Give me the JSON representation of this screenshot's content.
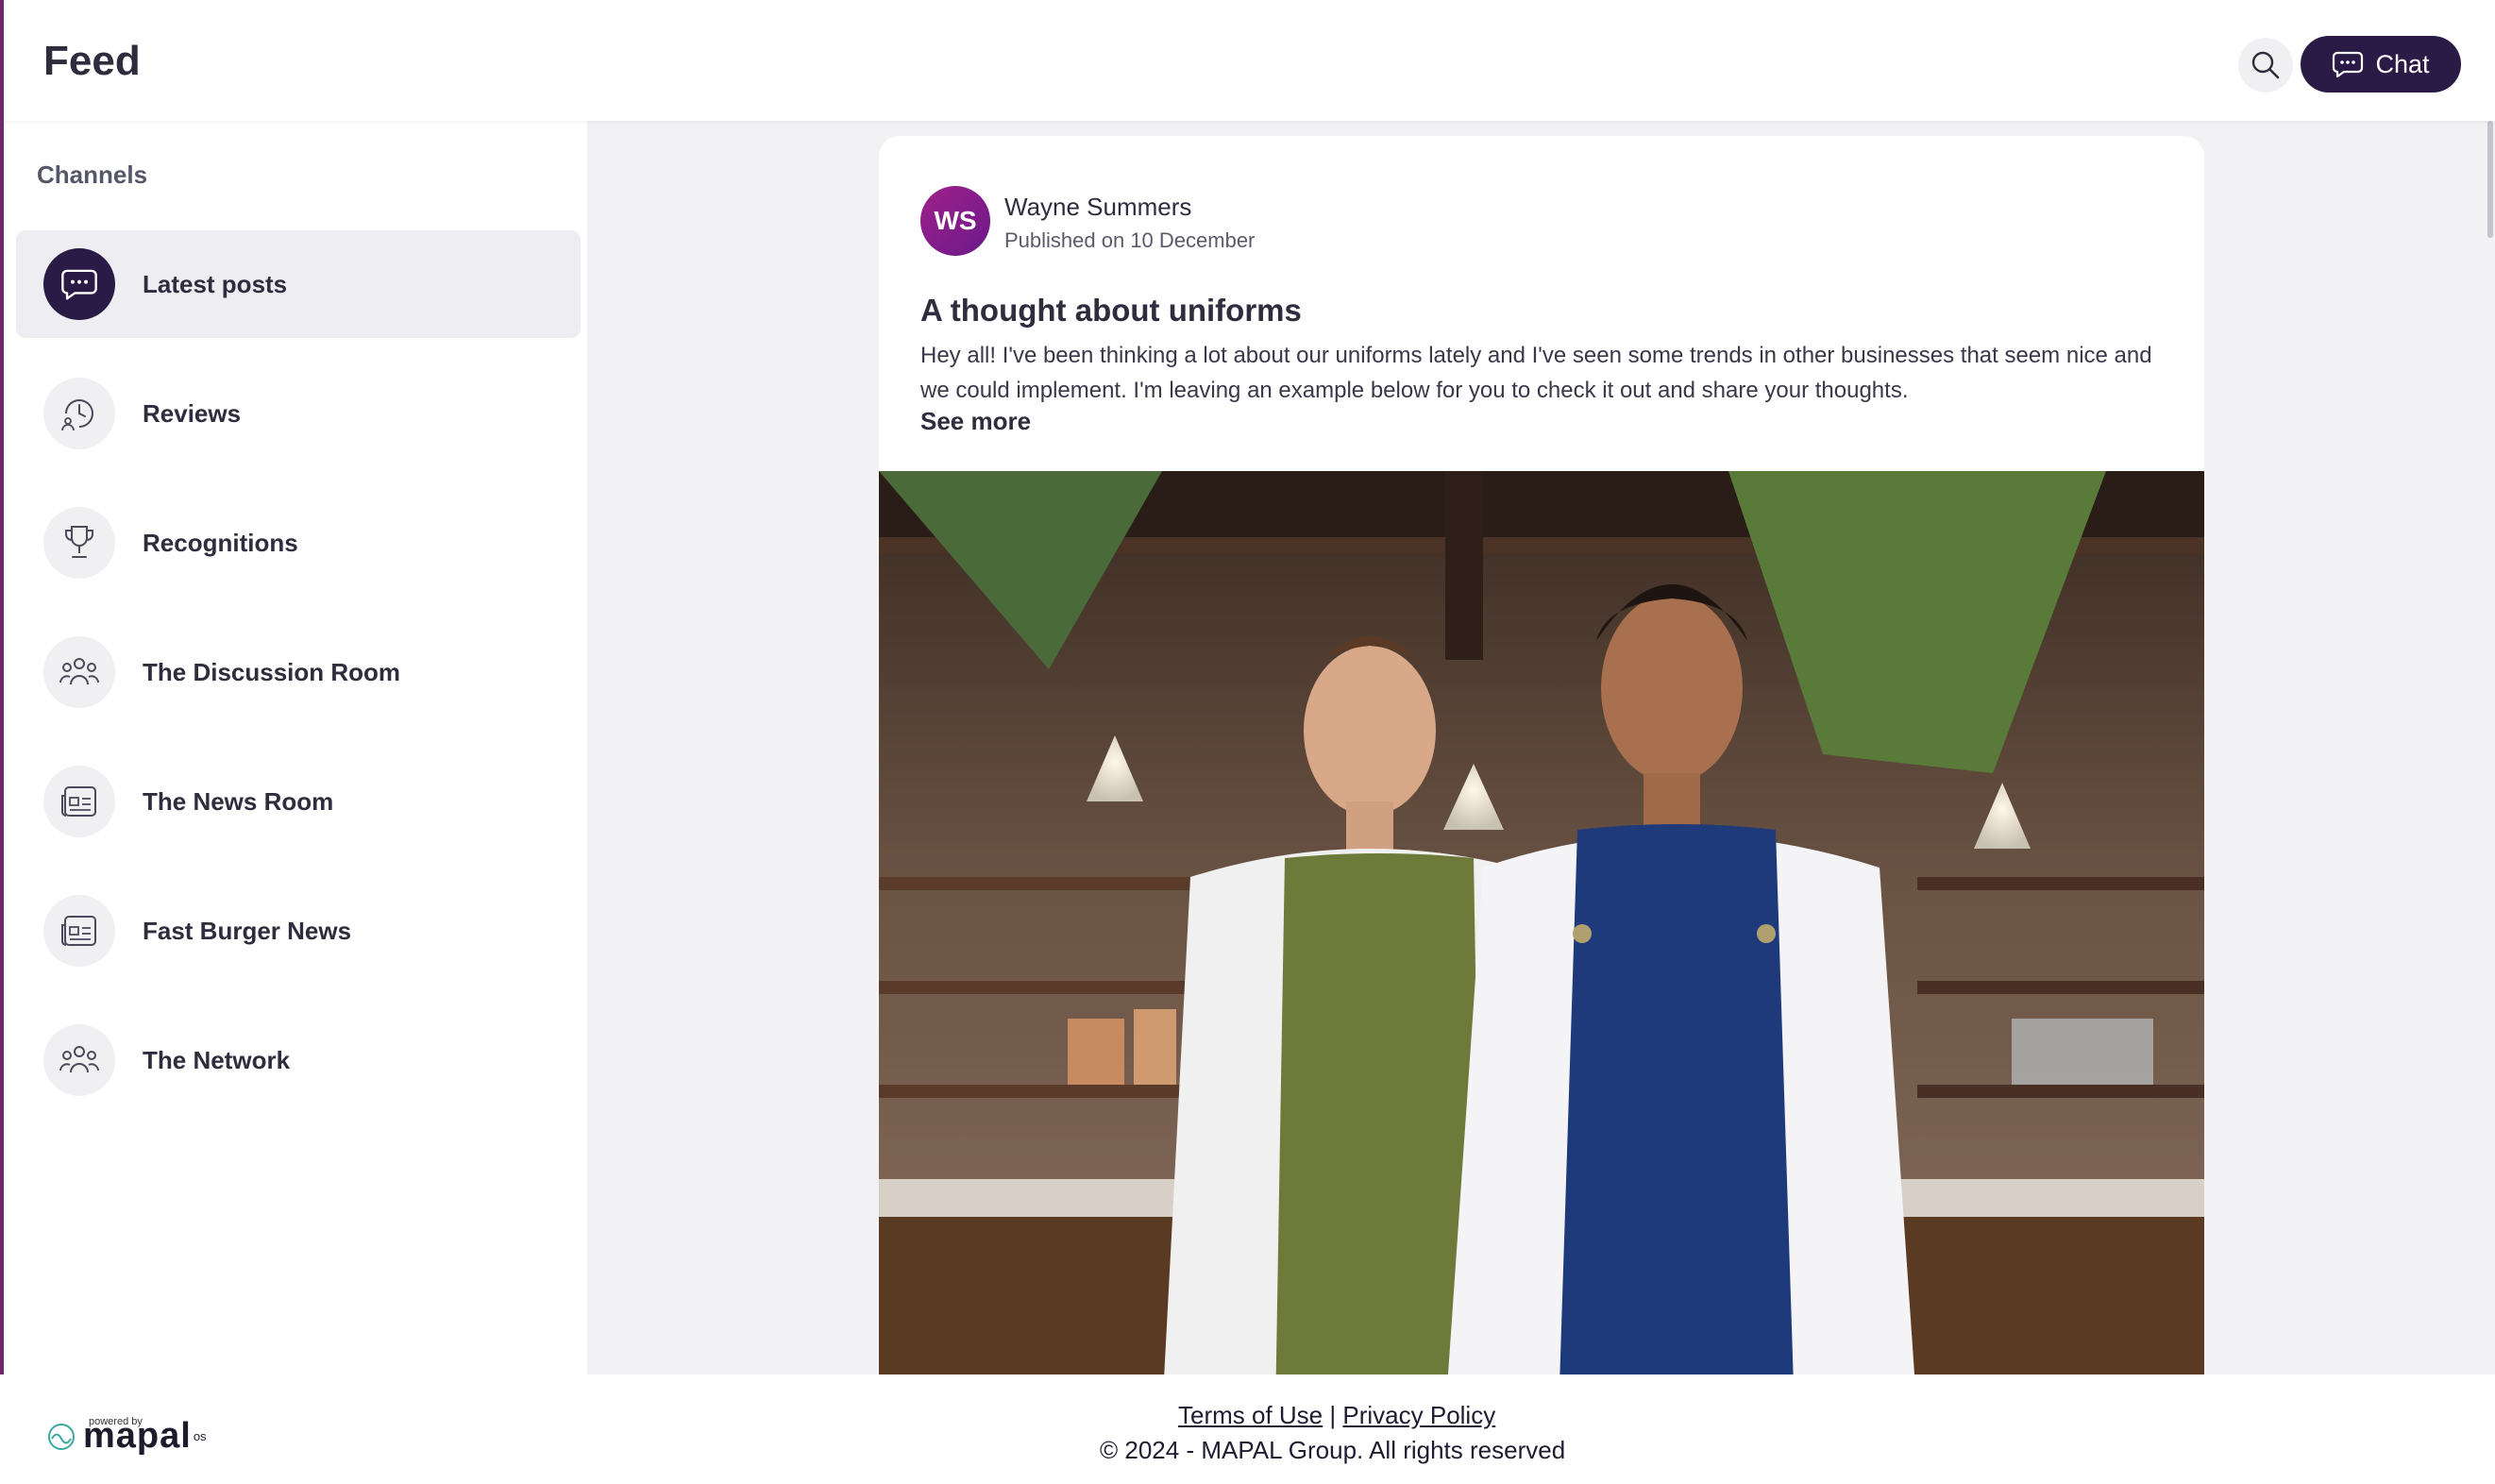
{
  "header": {
    "title": "Feed",
    "search_icon": "search-icon",
    "chat_label": "Chat",
    "chat_icon": "chat-bubble-icon"
  },
  "sidebar": {
    "heading": "Channels",
    "items": [
      {
        "label": "Latest posts",
        "icon": "chat-bubble-icon",
        "active": true
      },
      {
        "label": "Reviews",
        "icon": "history-user-icon",
        "active": false
      },
      {
        "label": "Recognitions",
        "icon": "trophy-icon",
        "active": false
      },
      {
        "label": "The Discussion Room",
        "icon": "people-group-icon",
        "active": false
      },
      {
        "label": "The News Room",
        "icon": "newspaper-icon",
        "active": false
      },
      {
        "label": "Fast Burger News",
        "icon": "newspaper-icon",
        "active": false
      },
      {
        "label": "The Network",
        "icon": "people-group-icon",
        "active": false
      }
    ]
  },
  "post": {
    "avatar_initials": "WS",
    "author": "Wayne Summers",
    "published": "Published on 10 December",
    "title": "A thought about uniforms",
    "body": "Hey all! I've been thinking a lot about our uniforms lately and I've seen some trends in other businesses that seem nice and we could implement. I'm leaving an example below for you to check it out and share your thoughts.",
    "see_more": "See more"
  },
  "footer": {
    "terms": "Terms of Use",
    "separator": "|",
    "privacy": "Privacy Policy",
    "copyright": "© 2024 - MAPAL Group. All rights reserved",
    "powered_by": "powered by",
    "logo_name": "mapal",
    "logo_suffix": "os"
  },
  "colors": {
    "brand_dark": "#2a1a46",
    "avatar_gradient_start": "#a0208a",
    "avatar_gradient_end": "#6a1a8a",
    "background_main": "#f2f2f5"
  }
}
